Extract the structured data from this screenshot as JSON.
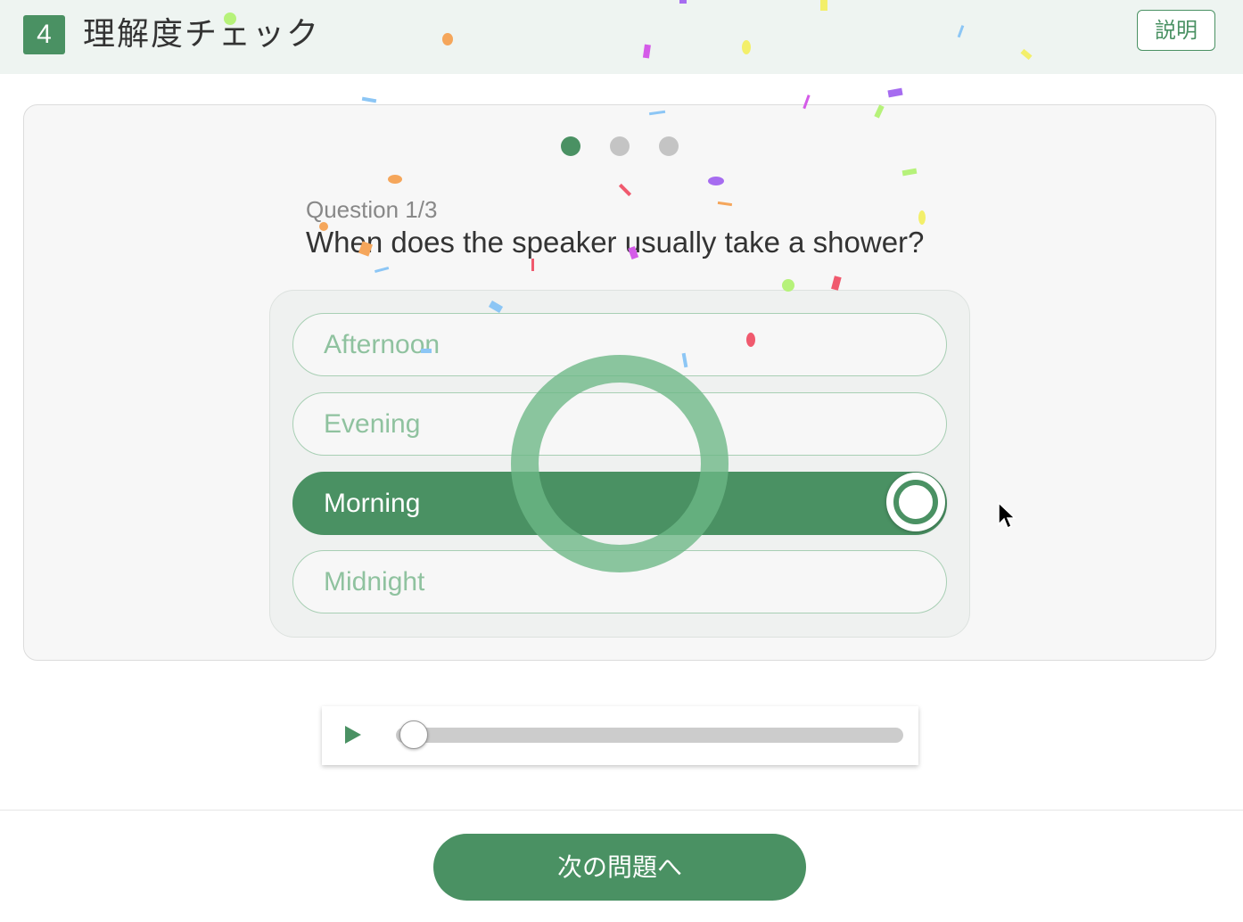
{
  "header": {
    "step_number": "4",
    "title": "理解度チェック",
    "explain_label": "説明"
  },
  "pagination": {
    "total": 3,
    "current": 1
  },
  "question": {
    "number_label": "Question 1/3",
    "text": "When does the speaker usually take a shower?"
  },
  "options": [
    {
      "label": "Afternoon",
      "selected": false
    },
    {
      "label": "Evening",
      "selected": false
    },
    {
      "label": "Morning",
      "selected": true
    },
    {
      "label": "Midnight",
      "selected": false
    }
  ],
  "feedback": {
    "result": "correct",
    "icon": "correct-circle-icon"
  },
  "audio_player": {
    "play_icon": "play-icon",
    "progress": 0.0
  },
  "footer": {
    "next_label": "次の問題へ"
  },
  "colors": {
    "accent": "#4a9163",
    "header_bg": "#eef4f1",
    "option_border": "#a8cfb4",
    "option_text": "#8fc29f",
    "correct_ring": "#6cb785",
    "dot_inactive": "#c4c4c4"
  }
}
